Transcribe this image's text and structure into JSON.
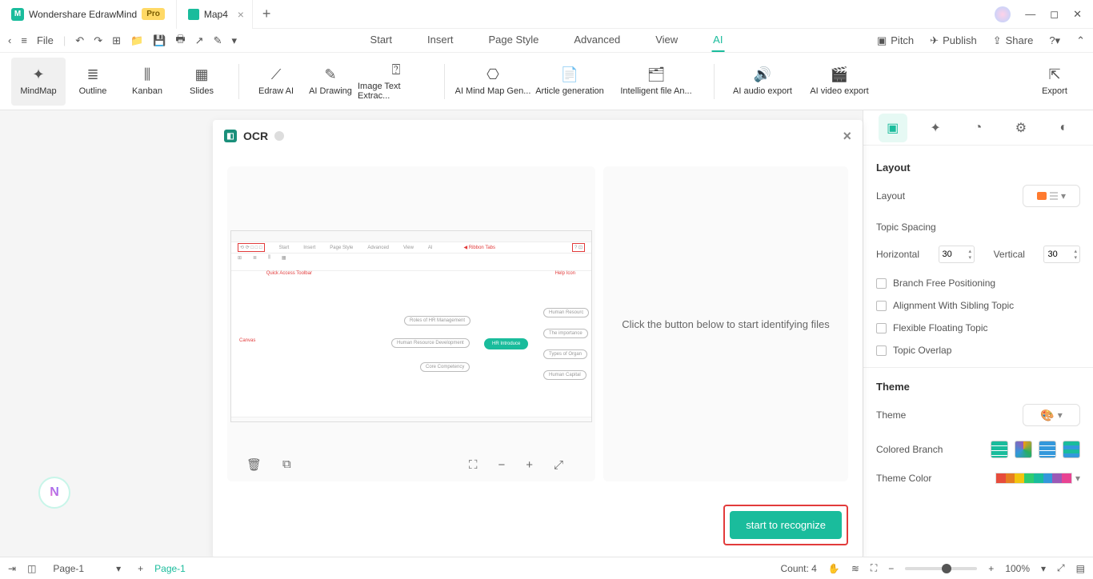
{
  "titlebar": {
    "app_name": "Wondershare EdrawMind",
    "pro": "Pro",
    "doc_tab": "Map4"
  },
  "qat": {
    "file": "File"
  },
  "menu": {
    "start": "Start",
    "insert": "Insert",
    "pagestyle": "Page Style",
    "advanced": "Advanced",
    "view": "View",
    "ai": "AI",
    "pitch": "Pitch",
    "publish": "Publish",
    "share": "Share"
  },
  "ribbon": {
    "mindmap": "MindMap",
    "outline": "Outline",
    "kanban": "Kanban",
    "slides": "Slides",
    "edrawai": "Edraw AI",
    "aidrawing": "AI Drawing",
    "imgtext": "Image Text Extrac...",
    "aimind": "AI Mind Map Gen...",
    "article": "Article generation",
    "intelfile": "Intelligent file An...",
    "audio": "AI audio export",
    "video": "AI video export",
    "export": "Export"
  },
  "ocr": {
    "title": "OCR",
    "hint": "Click the button below to start identifying files",
    "button": "start to recognize",
    "mock": {
      "ribbontabs": "Ribbon Tabs",
      "quickaccess": "Quick Access Toolbar",
      "helpicon": "Help Icon",
      "canvas_lbl": "Canvas",
      "menu": {
        "start": "Start",
        "insert": "Insert",
        "pagestyle": "Page Style",
        "advanced": "Advanced",
        "view": "View",
        "ai": "AI"
      },
      "nodes": {
        "center": "HR Introduce",
        "roles": "Roles of HR Management",
        "hrd": "Human Resource Development",
        "core": "Core Competency",
        "r1": "Human Resourc",
        "r2": "The importance",
        "r3": "Types of Organ",
        "r4": "Human Capital"
      }
    }
  },
  "side": {
    "layout_h": "Layout",
    "layout_lbl": "Layout",
    "spacing_h": "Topic Spacing",
    "horiz": "Horizontal",
    "horiz_v": "30",
    "vert": "Vertical",
    "vert_v": "30",
    "branchfree": "Branch Free Positioning",
    "align": "Alignment With Sibling Topic",
    "flex": "Flexible Floating Topic",
    "overlap": "Topic Overlap",
    "theme_h": "Theme",
    "theme_lbl": "Theme",
    "colored": "Colored Branch",
    "themecolor": "Theme Color"
  },
  "status": {
    "pagedd": "Page-1",
    "pagecur": "Page-1",
    "count": "Count: 4",
    "zoom": "100%"
  }
}
